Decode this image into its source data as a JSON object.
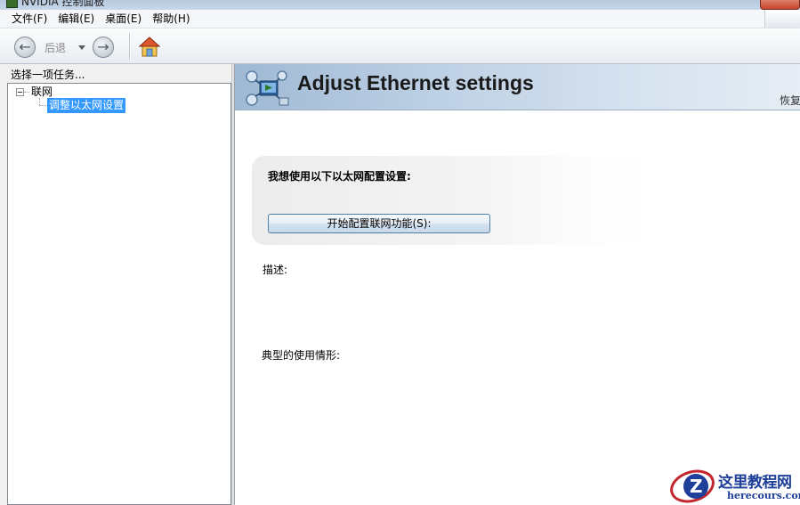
{
  "window": {
    "title": "NVIDIA 控制面板"
  },
  "menu": {
    "items": [
      "文件(F)",
      "编辑(E)",
      "桌面(E)",
      "帮助(H)"
    ]
  },
  "toolbar": {
    "back_label": "后退",
    "icons": [
      "back-arrow-icon",
      "history-dropdown-icon",
      "forward-arrow-icon",
      "home-icon"
    ]
  },
  "sidebar": {
    "header": "选择一项任务...",
    "tree": {
      "root_label": "联网",
      "child_label": "调整以太网设置",
      "selected": "调整以太网设置"
    }
  },
  "main": {
    "title": "Adjust Ethernet settings",
    "restore_label": "恢复",
    "question": "我想使用以下以太网配置设置:",
    "config_button": "开始配置联网功能(S):",
    "description_label": "描述:",
    "usage_label": "典型的使用情形:"
  },
  "watermark": {
    "title": "这里教程网",
    "url": "herecours.com"
  },
  "colors": {
    "selection": "#3399ff",
    "banner_start": "#9fb9d4",
    "banner_end": "#e6edf5",
    "watermark": "#1e3f9a",
    "watermark_logo_red": "#c2272d"
  }
}
